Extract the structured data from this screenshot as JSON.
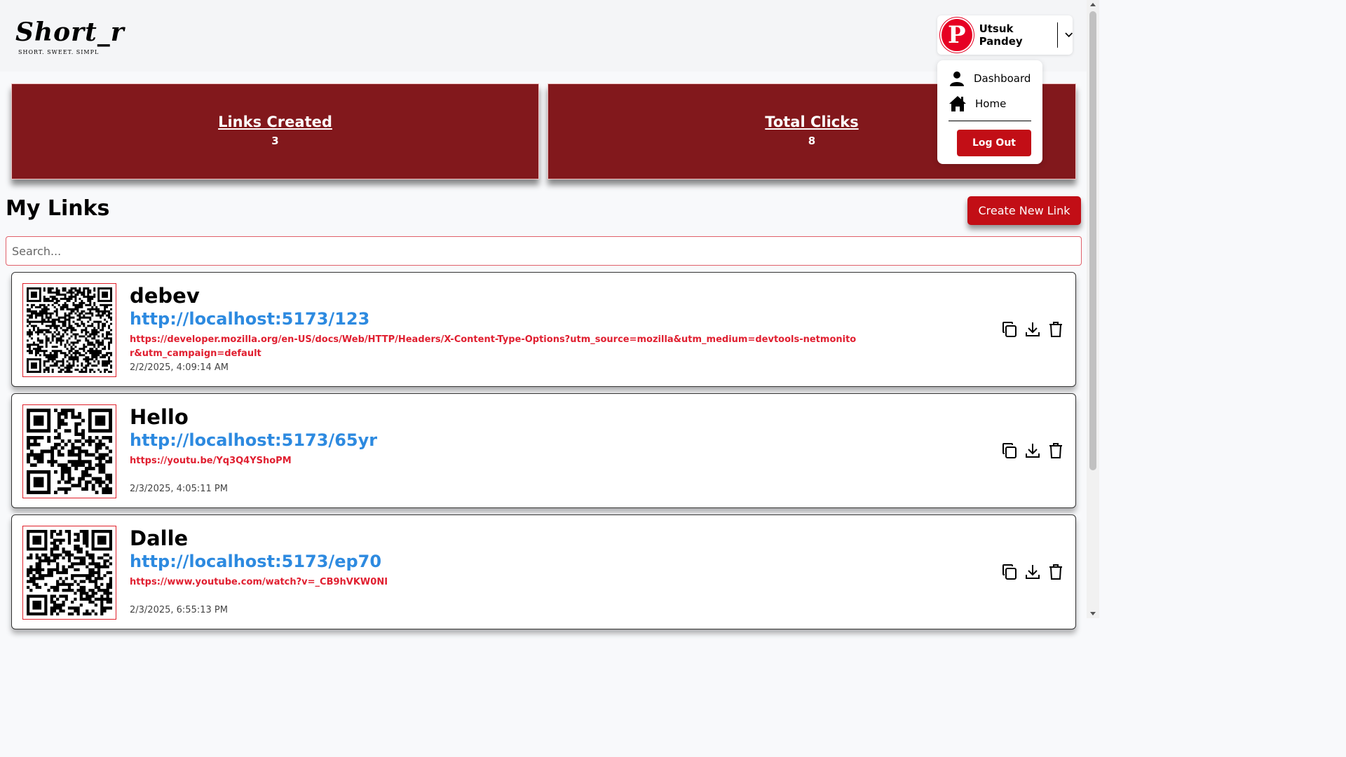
{
  "brand": {
    "name": "Short_r",
    "tagline": "SHORT. SWEET. SIMPL"
  },
  "user": {
    "name": "Utsuk Pandey",
    "avatar_glyph": "P",
    "avatar_icon": "pinterest-logo",
    "menu_icon": "chevron-down-icon"
  },
  "dropdown": {
    "items": [
      {
        "label": "Dashboard",
        "icon": "user-icon"
      },
      {
        "label": "Home",
        "icon": "home-icon"
      }
    ],
    "logout_label": "Log Out"
  },
  "stats": [
    {
      "title": "Links Created",
      "value": "3"
    },
    {
      "title": "Total Clicks",
      "value": "8"
    }
  ],
  "links_section": {
    "title": "My Links",
    "create_label": "Create New Link",
    "search_placeholder": "Search..."
  },
  "links": [
    {
      "title": "debev",
      "short_url": "http://localhost:5173/123",
      "original_url": "https://developer.mozilla.org/en-US/docs/Web/HTTP/Headers/X-Content-Type-Options?utm_source=mozilla&utm_medium=devtools-netmonitor&utm_campaign=default",
      "created": "2/2/2025, 4:09:14 AM"
    },
    {
      "title": "Hello",
      "short_url": "http://localhost:5173/65yr",
      "original_url": "https://youtu.be/Yq3Q4YShoPM",
      "created": "2/3/2025, 4:05:11 PM"
    },
    {
      "title": "Dalle",
      "short_url": "http://localhost:5173/ep70",
      "original_url": "https://www.youtube.com/watch?v=_CB9hVKW0NI",
      "created": "2/3/2025, 6:55:13 PM"
    }
  ],
  "action_icons": [
    "copy-icon",
    "download-icon",
    "trash-icon"
  ],
  "colors": {
    "brand_red": "#c20e16",
    "stat_bg": "#82181c",
    "link_blue": "#2d8ae0",
    "url_red": "#e01f30"
  }
}
